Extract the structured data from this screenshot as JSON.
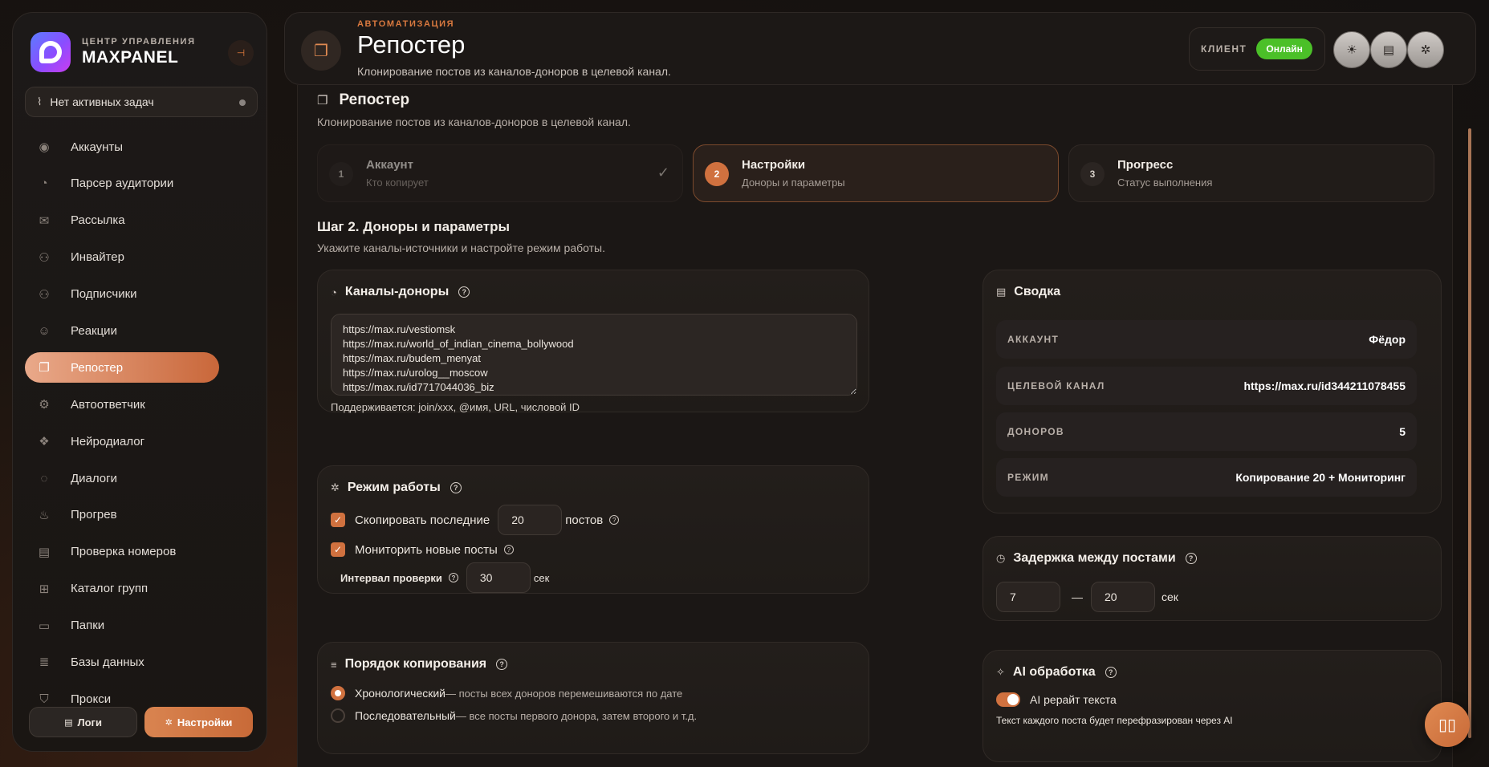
{
  "brand": {
    "subtitle": "ЦЕНТР УПРАВЛЕНИЯ",
    "name": "MAXPANEL"
  },
  "tasks": {
    "label": "Нет активных задач"
  },
  "nav": [
    {
      "label": "Аккаунты",
      "icon": "user-circle-icon"
    },
    {
      "label": "Парсер аудитории",
      "icon": "gauge-icon"
    },
    {
      "label": "Рассылка",
      "icon": "mail-icon"
    },
    {
      "label": "Инвайтер",
      "icon": "user-plus-icon"
    },
    {
      "label": "Подписчики",
      "icon": "users-icon"
    },
    {
      "label": "Реакции",
      "icon": "smile-icon"
    },
    {
      "label": "Репостер",
      "icon": "copy-icon",
      "active": true
    },
    {
      "label": "Автоответчик",
      "icon": "robot-icon"
    },
    {
      "label": "Нейродиалог",
      "icon": "brain-icon"
    },
    {
      "label": "Диалоги",
      "icon": "chat-icon"
    },
    {
      "label": "Прогрев",
      "icon": "flame-icon"
    },
    {
      "label": "Проверка номеров",
      "icon": "file-search-icon"
    },
    {
      "label": "Каталог групп",
      "icon": "grid-icon"
    },
    {
      "label": "Папки",
      "icon": "folder-icon"
    },
    {
      "label": "Базы данных",
      "icon": "database-icon"
    },
    {
      "label": "Прокси",
      "icon": "shield-icon"
    }
  ],
  "sidebar_buttons": {
    "logs": "Логи",
    "settings": "Настройки"
  },
  "header": {
    "eyebrow": "АВТОМАТИЗАЦИЯ",
    "title": "Репостер",
    "description": "Клонирование постов из каналов-доноров в целевой канал.",
    "client_label": "КЛИЕНТ",
    "client_status": "Онлайн"
  },
  "section": {
    "title": "Репостер",
    "description": "Клонирование постов из каналов-доноров в целевой канал."
  },
  "steps": [
    {
      "num": "1",
      "title": "Аккаунт",
      "subtitle": "Кто копирует",
      "state": "done"
    },
    {
      "num": "2",
      "title": "Настройки",
      "subtitle": "Доноры и параметры",
      "state": "active"
    },
    {
      "num": "3",
      "title": "Прогресс",
      "subtitle": "Статус выполнения",
      "state": "pending"
    }
  ],
  "step2": {
    "title": "Шаг 2. Доноры и параметры",
    "description": "Укажите каналы-источники и настройте режим работы."
  },
  "donors": {
    "title": "Каналы-доноры",
    "value": "https://max.ru/vestiomsk\nhttps://max.ru/world_of_indian_cinema_bollywood\nhttps://max.ru/budem_menyat\nhttps://max.ru/urolog__moscow\nhttps://max.ru/id7717044036_biz",
    "hint": "Поддерживается: join/xxx, @имя, URL, числовой ID"
  },
  "mode": {
    "title": "Режим работы",
    "copy_label": "Скопировать последние",
    "copy_count": "20",
    "copy_unit": "постов",
    "monitor_label": "Мониторить новые посты",
    "interval_label": "Интервал проверки",
    "interval_value": "30",
    "interval_unit": "сек"
  },
  "order": {
    "title": "Порядок копирования",
    "opt1_name": "Хронологический",
    "opt1_desc": " — посты всех доноров перемешиваются по дате",
    "opt2_name": "Последовательный",
    "opt2_desc": " — все посты первого донора, затем второго и т.д."
  },
  "summary": {
    "title": "Сводка",
    "rows": [
      {
        "key": "АККАУНТ",
        "value": "Фёдор"
      },
      {
        "key": "ЦЕЛЕВОЙ КАНАЛ",
        "value": "https://max.ru/id344211078455"
      },
      {
        "key": "ДОНОРОВ",
        "value": "5"
      },
      {
        "key": "РЕЖИМ",
        "value": "Копирование 20 + Мониторинг"
      }
    ]
  },
  "delay": {
    "title": "Задержка между постами",
    "min": "7",
    "sep": "—",
    "max": "20",
    "unit": "сек"
  },
  "ai": {
    "title": "AI обработка",
    "toggle_label": "AI рерайт текста",
    "hint": "Текст каждого поста будет перефразирован через AI"
  },
  "colors": {
    "accent": "#d0713f",
    "online": "#4bc028",
    "bg": "#141110"
  }
}
